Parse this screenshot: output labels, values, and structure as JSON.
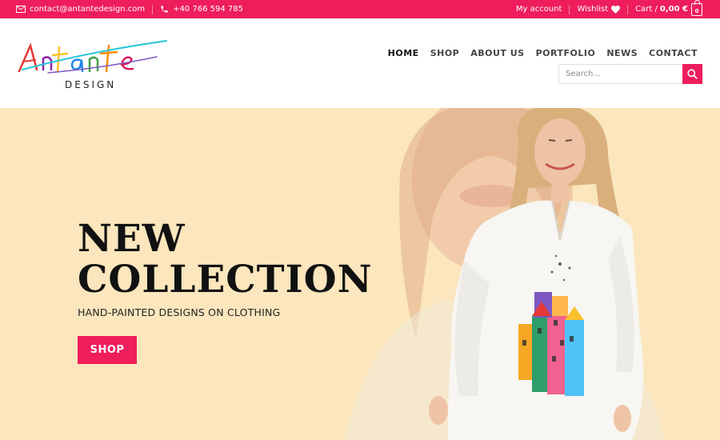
{
  "topbar": {
    "email": "contact@antantedesign.com",
    "phone": "+40 766 594 785",
    "my_account": "My account",
    "wishlist": "Wishlist",
    "cart_label": "Cart /",
    "cart_amount": "0,00 €",
    "cart_count": "0"
  },
  "brand": {
    "logo_text": "Antante",
    "logo_sub": "DESIGN"
  },
  "nav": {
    "items": [
      "HOME",
      "SHOP",
      "ABOUT US",
      "PORTFOLIO",
      "NEWS",
      "CONTACT"
    ],
    "active": "HOME"
  },
  "search": {
    "placeholder": "Search..."
  },
  "hero": {
    "title_line1": "NEW",
    "title_line2": "COLLECTION",
    "subtitle": "HAND-PAINTED DESIGNS ON CLOTHING",
    "button": "SHOP"
  },
  "colors": {
    "accent": "#ee1d5c",
    "hero_bg": "#fbe6bd"
  },
  "icons": {
    "email": "envelope-icon",
    "phone": "phone-icon",
    "wishlist": "heart-icon",
    "cart": "shopping-bag-icon",
    "search": "search-icon"
  }
}
